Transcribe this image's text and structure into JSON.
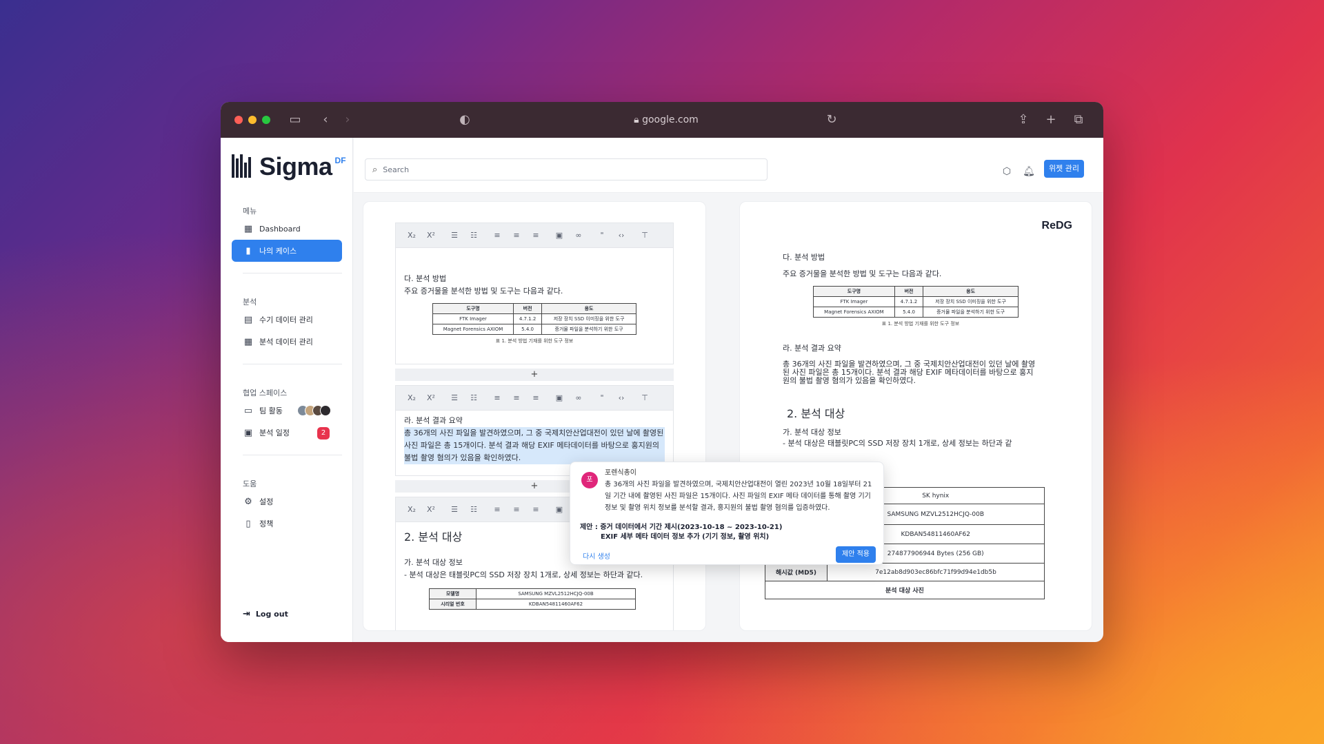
{
  "browser": {
    "url": "google.com"
  },
  "brand": {
    "name": "Sigma",
    "sup": "DF"
  },
  "sidebar": {
    "menu_label": "메뉴",
    "dashboard": "Dashboard",
    "my_cases": "나의 케이스",
    "analysis_label": "분석",
    "manual_data": "수기 데이터 관리",
    "analysis_data": "분석 데이터 관리",
    "collab_label": "협업 스페이스",
    "team_activity": "팀 활동",
    "analysis_schedule": "분석 일정",
    "schedule_badge": "2",
    "help_label": "도움",
    "settings": "설정",
    "policy": "정책",
    "logout": "Log out"
  },
  "topbar": {
    "search_placeholder": "Search",
    "widget_button": "위젯 관리"
  },
  "toolbar": [
    "X₂",
    "X²",
    "≡",
    "≔",
    "≡",
    "≡",
    "≡",
    "▣",
    "⊘",
    "\"",
    "<>",
    "⊤"
  ],
  "editor": {
    "block1": {
      "heading": "다. 분석 방법",
      "line": "주요 증거물을 분석한 방법 및 도구는 다음과 같다.",
      "table_headers": [
        "도구명",
        "버전",
        "용도"
      ],
      "table_rows": [
        [
          "FTK Imager",
          "4.7.1.2",
          "저장 장치 SSD 이미징을 위한 도구"
        ],
        [
          "Magnet Forensics AXIOM",
          "5.4.0",
          "증거물 파일을 분석하기 위한 도구"
        ]
      ],
      "caption": "표 1. 분석 방법 기재를 위한 도구 정보"
    },
    "block2": {
      "heading": "라. 분석 결과 요약",
      "body": "총 36개의 사진 파일을 발견하였으며, 그 중 국제치안산업대전이 있던 날에 촬영된 사진 파일은 총 15개이다. 분석 결과 해당 EXIF 메타데이터를 바탕으로 홍지원의 불법 촬영 혐의가 있음을 확인하였다."
    },
    "block3": {
      "heading": "2. 분석 대상",
      "sub": "가. 분석 대상 정보",
      "line": "- 분석 대상은 태블릿PC의 SSD 저장 장치 1개로, 상세 정보는 하단과 같다.",
      "rows": [
        [
          "모델명",
          "SAMSUNG MZVL2512HCJQ-00B"
        ],
        [
          "시리얼 번호",
          "KDBAN54811460AF62"
        ]
      ]
    }
  },
  "popup": {
    "avatar": "포",
    "name": "포렌식총이",
    "body": "총 36개의 사진 파일을 발견하였으며, 국제치안산업대전이 열린 2023년 10월 18일부터 21일 기간 내에 촬영된 사진 파일은 15개이다. 사진 파일의 EXIF 메타 데이터를 통해 촬영 기기 정보 및 촬영 위치 정보를 분석할 결과, 홍지원의 불법 촬영 혐의를 입증하였다.",
    "suggestion_1": "제안 : 증거 데이터에서 기간 제시(2023-10-18 ~ 2023-10-21)",
    "suggestion_2": "EXIF 세부 메타 데이터 정보 추가 (기기 정보, 촬영 위치)",
    "regenerate": "다시 생성",
    "apply": "제안 적용"
  },
  "preview": {
    "logo": "ReDG",
    "heading1": "다. 분석 방법",
    "line1": "주요 증거물을 분석한 방법 및 도구는 다음과 같다.",
    "caption": "표 1. 분석 방법 기재를 위한 도구 정보",
    "heading2": "라. 분석 결과 요약",
    "body2": "총 36개의 사진 파일을 발견하였으며, 그 중 국제치안산업대전이 있던 날에 촬영된 사진 파일은 총 15개이다. 분석 결과 해당 EXIF 메타데이터를 바탕으로 홍지원의 불법 촬영 혐의가 있음을 확인하였다.",
    "heading3": "2. 분석 대상",
    "sub3": "가. 분석 대상 정보",
    "line3": "- 분석 대상은 태블릿PC의 SSD 저장 장치 1개로, 상세 정보는 하단과 같",
    "rows": [
      "SK hynix",
      "SAMSUNG MZVL2512HCJQ-00B",
      "KDBAN54811460AF62",
      "274877906944 Bytes (256 GB)"
    ],
    "hash_label": "해시값 (MD5)",
    "hash_value": "7e12ab8d903ec86bfc71f99d94e1db5b",
    "photo_label": "분석 대상 사진"
  }
}
